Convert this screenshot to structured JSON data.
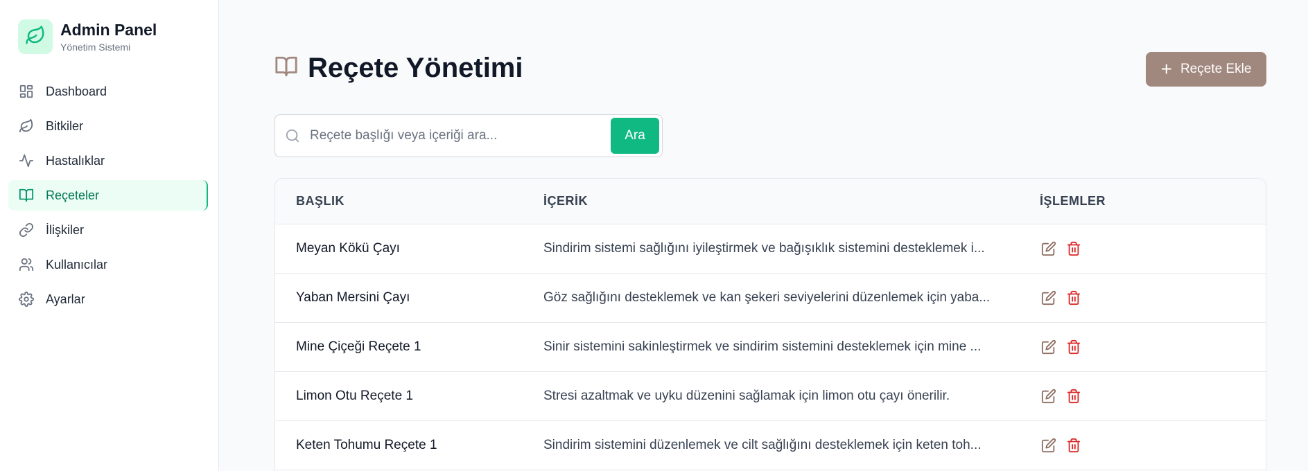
{
  "sidebar": {
    "brand_title": "Admin Panel",
    "brand_subtitle": "Yönetim Sistemi",
    "brand_icon": "leaf-icon",
    "items": [
      {
        "label": "Dashboard",
        "icon": "dashboard-icon"
      },
      {
        "label": "Bitkiler",
        "icon": "leaf-icon"
      },
      {
        "label": "Hastalıklar",
        "icon": "activity-icon"
      },
      {
        "label": "Reçeteler",
        "icon": "book-icon",
        "active": true
      },
      {
        "label": "İlişkiler",
        "icon": "link-icon"
      },
      {
        "label": "Kullanıcılar",
        "icon": "users-icon"
      },
      {
        "label": "Ayarlar",
        "icon": "gear-icon"
      }
    ]
  },
  "header": {
    "title": "Reçete Yönetimi",
    "title_icon": "book-icon",
    "add_button": "Reçete Ekle"
  },
  "search": {
    "placeholder": "Reçete başlığı veya içeriği ara...",
    "button": "Ara"
  },
  "table": {
    "columns": [
      "BAŞLIK",
      "İÇERİK",
      "İŞLEMLER"
    ],
    "rows": [
      {
        "title": "Meyan Kökü Çayı",
        "content": "Sindirim sistemi sağlığını iyileştirmek ve bağışıklık sistemini desteklemek i..."
      },
      {
        "title": "Yaban Mersini Çayı",
        "content": "Göz sağlığını desteklemek ve kan şekeri seviyelerini düzenlemek için yaba..."
      },
      {
        "title": "Mine Çiçeği Reçete 1",
        "content": "Sinir sistemini sakinleştirmek ve sindirim sistemini desteklemek için mine ..."
      },
      {
        "title": "Limon Otu Reçete 1",
        "content": "Stresi azaltmak ve uyku düzenini sağlamak için limon otu çayı önerilir."
      },
      {
        "title": "Keten Tohumu Reçete 1",
        "content": "Sindirim sistemini düzenlemek ve cilt sağlığını desteklemek için keten toh..."
      }
    ]
  },
  "colors": {
    "accent": "#10b981",
    "brown": "#a1887f",
    "danger": "#dc2626",
    "edit": "#8d6e63"
  }
}
